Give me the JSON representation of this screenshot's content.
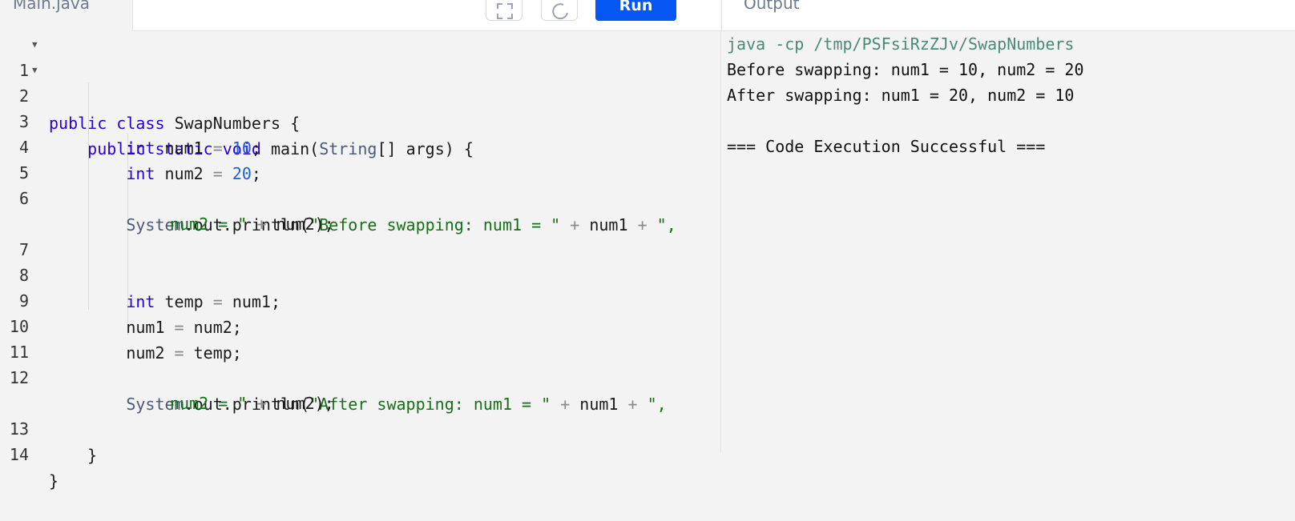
{
  "editor": {
    "filename": "Main.java",
    "run_label": "Run",
    "lines": [
      {
        "num": "1",
        "fold": true
      },
      {
        "num": "2",
        "fold": true
      },
      {
        "num": "3"
      },
      {
        "num": "4"
      },
      {
        "num": "5"
      },
      {
        "num": "6"
      },
      {
        "num": "7"
      },
      {
        "num": "8"
      },
      {
        "num": "9"
      },
      {
        "num": "10"
      },
      {
        "num": "11"
      },
      {
        "num": "12"
      },
      {
        "num": "13"
      },
      {
        "num": "14"
      }
    ],
    "code": {
      "l1": {
        "kw1": "public",
        "kw2": "class",
        "name": "SwapNumbers",
        "brace": "{"
      },
      "l2": {
        "kw1": "public",
        "kw2": "static",
        "kw3": "void",
        "name": "main",
        "open": "(",
        "type": "String",
        "rest": "[] args) {"
      },
      "l3": {
        "type": "int",
        "var": "num1",
        "eq": "=",
        "val": "10",
        "semi": ";"
      },
      "l4": {
        "type": "int",
        "var": "num2",
        "eq": "=",
        "val": "20",
        "semi": ";"
      },
      "l6": {
        "cls": "System",
        "call": ".out.println(",
        "str1": "\"Before swapping: num1 = \"",
        "plus1": "+",
        "v1": "num1",
        "plus2": "+",
        "str2a": "\","
      },
      "l6w": {
        "str2b": "num2 = \"",
        "plus3": "+",
        "v2": "num2);"
      },
      "l8": {
        "type": "int",
        "var": "temp",
        "eq": "=",
        "rhs": "num1;"
      },
      "l9": {
        "var": "num1",
        "eq": "=",
        "rhs": "num2;"
      },
      "l10": {
        "var": "num2",
        "eq": "=",
        "rhs": "temp;"
      },
      "l12": {
        "cls": "System",
        "call": ".out.println(",
        "str1": "\"After swapping: num1 = \"",
        "plus1": "+",
        "v1": "num1",
        "plus2": "+",
        "str2a": "\","
      },
      "l12w": {
        "str2b": "num2 = \"",
        "plus3": "+",
        "v2": "num2);"
      },
      "l13": {
        "brace": "}"
      },
      "l14": {
        "brace": "}"
      }
    }
  },
  "output": {
    "title": "Output",
    "command": "java -cp /tmp/PSFsiRzZJv/SwapNumbers",
    "line1": "Before swapping: num1 = 10, num2 = 20",
    "line2": "After swapping: num1 = 20, num2 = 10",
    "status": "=== Code Execution Successful ==="
  },
  "icons": [
    "fullscreen-icon",
    "theme-toggle-icon",
    "fold-arrow-icon"
  ],
  "colors": {
    "run_button": "#0556f3",
    "keyword": "#2a00d6",
    "string": "#157015",
    "command": "#4a8a78"
  }
}
